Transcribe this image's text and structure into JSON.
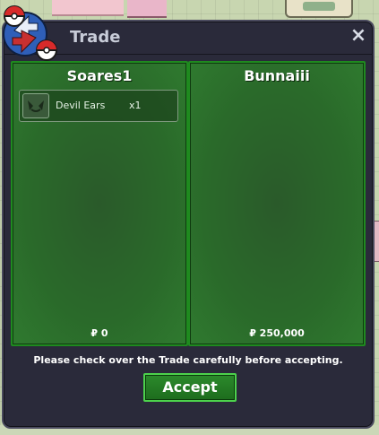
{
  "window": {
    "title": "Trade",
    "close_label": "×"
  },
  "panels": [
    {
      "player": "Soares1",
      "items": [
        {
          "name": "Devil Ears",
          "quantity": "x1",
          "icon": "devil-ears-icon"
        }
      ],
      "money": "₽ 0"
    },
    {
      "player": "Bunnaiii",
      "items": [],
      "money": "₽ 250,000"
    }
  ],
  "footer": {
    "notice": "Please check over the Trade carefully before accepting.",
    "accept_label": "Accept"
  },
  "colors": {
    "window_bg": "#2a2a3a",
    "panel_green": "#2a6a2a",
    "panel_border": "#1f8a1f",
    "accept_border": "#4cd24c",
    "title_text": "#c8ccd8"
  }
}
